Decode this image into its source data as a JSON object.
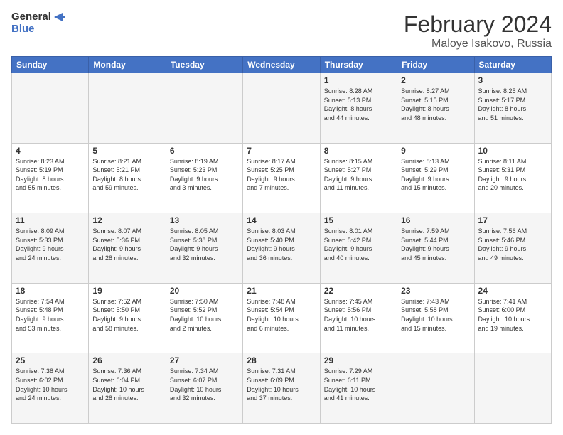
{
  "logo": {
    "text_general": "General",
    "text_blue": "Blue"
  },
  "header": {
    "title": "February 2024",
    "subtitle": "Maloye Isakovo, Russia"
  },
  "days_of_week": [
    "Sunday",
    "Monday",
    "Tuesday",
    "Wednesday",
    "Thursday",
    "Friday",
    "Saturday"
  ],
  "weeks": [
    {
      "days": [
        {
          "num": "",
          "info": ""
        },
        {
          "num": "",
          "info": ""
        },
        {
          "num": "",
          "info": ""
        },
        {
          "num": "",
          "info": ""
        },
        {
          "num": "1",
          "info": "Sunrise: 8:28 AM\nSunset: 5:13 PM\nDaylight: 8 hours\nand 44 minutes."
        },
        {
          "num": "2",
          "info": "Sunrise: 8:27 AM\nSunset: 5:15 PM\nDaylight: 8 hours\nand 48 minutes."
        },
        {
          "num": "3",
          "info": "Sunrise: 8:25 AM\nSunset: 5:17 PM\nDaylight: 8 hours\nand 51 minutes."
        }
      ]
    },
    {
      "days": [
        {
          "num": "4",
          "info": "Sunrise: 8:23 AM\nSunset: 5:19 PM\nDaylight: 8 hours\nand 55 minutes."
        },
        {
          "num": "5",
          "info": "Sunrise: 8:21 AM\nSunset: 5:21 PM\nDaylight: 8 hours\nand 59 minutes."
        },
        {
          "num": "6",
          "info": "Sunrise: 8:19 AM\nSunset: 5:23 PM\nDaylight: 9 hours\nand 3 minutes."
        },
        {
          "num": "7",
          "info": "Sunrise: 8:17 AM\nSunset: 5:25 PM\nDaylight: 9 hours\nand 7 minutes."
        },
        {
          "num": "8",
          "info": "Sunrise: 8:15 AM\nSunset: 5:27 PM\nDaylight: 9 hours\nand 11 minutes."
        },
        {
          "num": "9",
          "info": "Sunrise: 8:13 AM\nSunset: 5:29 PM\nDaylight: 9 hours\nand 15 minutes."
        },
        {
          "num": "10",
          "info": "Sunrise: 8:11 AM\nSunset: 5:31 PM\nDaylight: 9 hours\nand 20 minutes."
        }
      ]
    },
    {
      "days": [
        {
          "num": "11",
          "info": "Sunrise: 8:09 AM\nSunset: 5:33 PM\nDaylight: 9 hours\nand 24 minutes."
        },
        {
          "num": "12",
          "info": "Sunrise: 8:07 AM\nSunset: 5:36 PM\nDaylight: 9 hours\nand 28 minutes."
        },
        {
          "num": "13",
          "info": "Sunrise: 8:05 AM\nSunset: 5:38 PM\nDaylight: 9 hours\nand 32 minutes."
        },
        {
          "num": "14",
          "info": "Sunrise: 8:03 AM\nSunset: 5:40 PM\nDaylight: 9 hours\nand 36 minutes."
        },
        {
          "num": "15",
          "info": "Sunrise: 8:01 AM\nSunset: 5:42 PM\nDaylight: 9 hours\nand 40 minutes."
        },
        {
          "num": "16",
          "info": "Sunrise: 7:59 AM\nSunset: 5:44 PM\nDaylight: 9 hours\nand 45 minutes."
        },
        {
          "num": "17",
          "info": "Sunrise: 7:56 AM\nSunset: 5:46 PM\nDaylight: 9 hours\nand 49 minutes."
        }
      ]
    },
    {
      "days": [
        {
          "num": "18",
          "info": "Sunrise: 7:54 AM\nSunset: 5:48 PM\nDaylight: 9 hours\nand 53 minutes."
        },
        {
          "num": "19",
          "info": "Sunrise: 7:52 AM\nSunset: 5:50 PM\nDaylight: 9 hours\nand 58 minutes."
        },
        {
          "num": "20",
          "info": "Sunrise: 7:50 AM\nSunset: 5:52 PM\nDaylight: 10 hours\nand 2 minutes."
        },
        {
          "num": "21",
          "info": "Sunrise: 7:48 AM\nSunset: 5:54 PM\nDaylight: 10 hours\nand 6 minutes."
        },
        {
          "num": "22",
          "info": "Sunrise: 7:45 AM\nSunset: 5:56 PM\nDaylight: 10 hours\nand 11 minutes."
        },
        {
          "num": "23",
          "info": "Sunrise: 7:43 AM\nSunset: 5:58 PM\nDaylight: 10 hours\nand 15 minutes."
        },
        {
          "num": "24",
          "info": "Sunrise: 7:41 AM\nSunset: 6:00 PM\nDaylight: 10 hours\nand 19 minutes."
        }
      ]
    },
    {
      "days": [
        {
          "num": "25",
          "info": "Sunrise: 7:38 AM\nSunset: 6:02 PM\nDaylight: 10 hours\nand 24 minutes."
        },
        {
          "num": "26",
          "info": "Sunrise: 7:36 AM\nSunset: 6:04 PM\nDaylight: 10 hours\nand 28 minutes."
        },
        {
          "num": "27",
          "info": "Sunrise: 7:34 AM\nSunset: 6:07 PM\nDaylight: 10 hours\nand 32 minutes."
        },
        {
          "num": "28",
          "info": "Sunrise: 7:31 AM\nSunset: 6:09 PM\nDaylight: 10 hours\nand 37 minutes."
        },
        {
          "num": "29",
          "info": "Sunrise: 7:29 AM\nSunset: 6:11 PM\nDaylight: 10 hours\nand 41 minutes."
        },
        {
          "num": "",
          "info": ""
        },
        {
          "num": "",
          "info": ""
        }
      ]
    }
  ]
}
